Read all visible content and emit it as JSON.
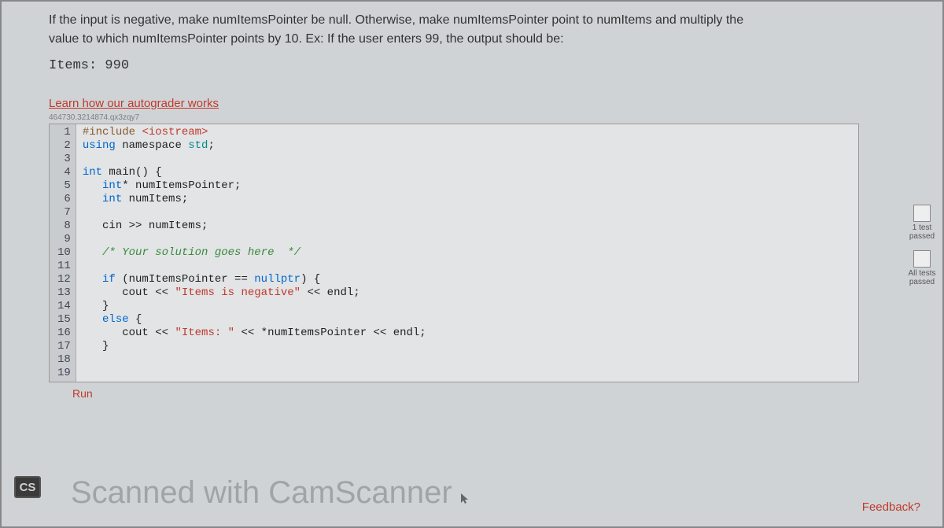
{
  "instructions": {
    "line1": "If the input is negative, make numItemsPointer be null. Otherwise, make numItemsPointer point to numItems and multiply the",
    "line2": "value to which numItemsPointer points by 10. Ex: If the user enters 99, the output should be:"
  },
  "example_output": "Items: 990",
  "autograder_link": "Learn how our autograder works",
  "session_id": "464730.3214874.qx3zqy7",
  "code": {
    "lines": [
      "1",
      "2",
      "3",
      "4",
      "5",
      "6",
      "7",
      "8",
      "9",
      "10",
      "11",
      "12",
      "13",
      "14",
      "15",
      "16",
      "17",
      "18",
      "19"
    ],
    "l1_a": "#include ",
    "l1_b": "<iostream>",
    "l2_a": "using",
    "l2_b": " namespace ",
    "l2_c": "std",
    "l2_d": ";",
    "l4_a": "int",
    "l4_b": " main() {",
    "l5_a": "   int",
    "l5_b": "* numItemsPointer;",
    "l6_a": "   int",
    "l6_b": " numItems;",
    "l8": "   cin >> numItems;",
    "l10_a": "   ",
    "l10_b": "/* Your solution goes here  */",
    "l12_a": "   if",
    "l12_b": " (numItemsPointer == ",
    "l12_c": "nullptr",
    "l12_d": ") {",
    "l13_a": "      cout << ",
    "l13_b": "\"Items is negative\"",
    "l13_c": " << endl;",
    "l14": "   }",
    "l15_a": "   else",
    "l15_b": " {",
    "l16_a": "      cout << ",
    "l16_b": "\"Items: \"",
    "l16_c": " << *numItemsPointer << endl;",
    "l17": "   }"
  },
  "run_button": "Run",
  "status": {
    "one_test": "1 test",
    "passed": "passed",
    "all_tests": "All tests"
  },
  "cs_badge": "CS",
  "watermark": "Scanned with CamScanner",
  "feedback": "Feedback?"
}
